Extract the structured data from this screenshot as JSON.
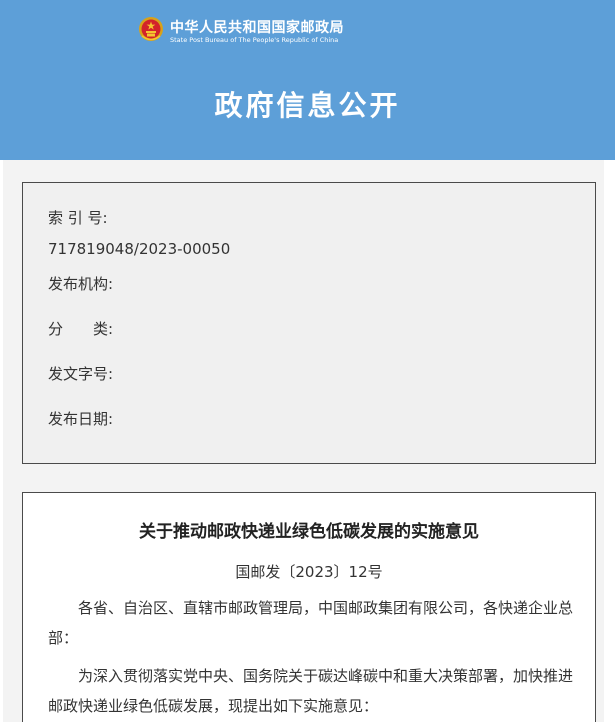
{
  "header": {
    "org_name_cn": "中华人民共和国国家邮政局",
    "org_name_en": "State Post Bureau of The People's Republic of China",
    "title": "政府信息公开",
    "background_color": "#5d9fd8",
    "emblem_icon": "national-emblem-icon"
  },
  "meta": {
    "index_label": "索 引 号:",
    "index_value": "717819048/2023-00050",
    "publisher_label": "发布机构:",
    "category_label": "分　　类:",
    "doc_number_label": "发文字号:",
    "publish_date_label": "发布日期:"
  },
  "document": {
    "title": "关于推动邮政快递业绿色低碳发展的实施意见",
    "number": "国邮发〔2023〕12号",
    "para_1": "各省、自治区、直辖市邮政管理局，中国邮政集团有限公司，各快递企业总部：",
    "para_2": "为深入贯彻落实党中央、国务院关于碳达峰碳中和重大决策部署，加快推进邮政快递业绿色低碳发展，现提出如下实施意见："
  }
}
